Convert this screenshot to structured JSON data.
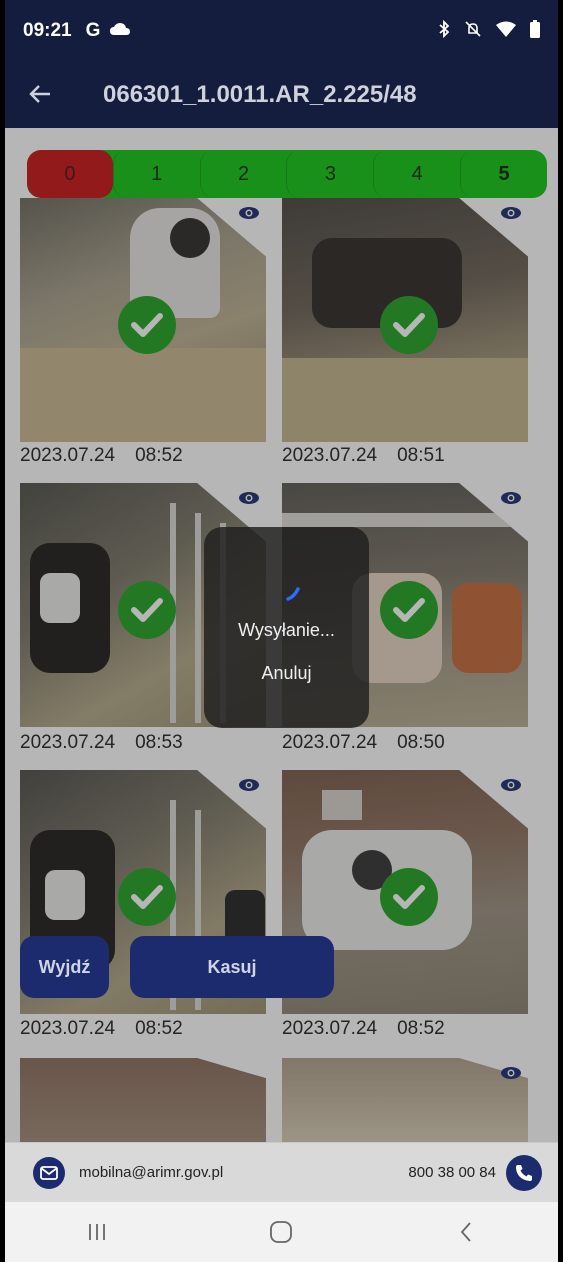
{
  "status_bar": {
    "time": "09:21",
    "g_label": "G"
  },
  "app_bar": {
    "title": "066301_1.0011.AR_2.225/48"
  },
  "rating": {
    "items": [
      "0",
      "1",
      "2",
      "3",
      "4",
      "5"
    ],
    "selected": "0"
  },
  "photos": [
    {
      "date": "2023.07.24",
      "time": "08:52",
      "verified": true
    },
    {
      "date": "2023.07.24",
      "time": "08:51",
      "verified": true
    },
    {
      "date": "2023.07.24",
      "time": "08:53",
      "verified": true
    },
    {
      "date": "2023.07.24",
      "time": "08:50",
      "verified": true
    },
    {
      "date": "2023.07.24",
      "time": "08:52",
      "verified": true
    },
    {
      "date": "2023.07.24",
      "time": "08:52",
      "verified": true
    }
  ],
  "buttons": {
    "exit": "Wyjdź",
    "delete": "Kasuj"
  },
  "dialog": {
    "message": "Wysyłanie...",
    "cancel": "Anuluj"
  },
  "footer": {
    "email": "mobilna@arimr.gov.pl",
    "phone": "800 38 00 84"
  },
  "colors": {
    "header": "#141d3d",
    "accent": "#1b2b6e",
    "rating_green": "#12c512",
    "rating_red": "#c81313",
    "check_green": "#21a321"
  }
}
